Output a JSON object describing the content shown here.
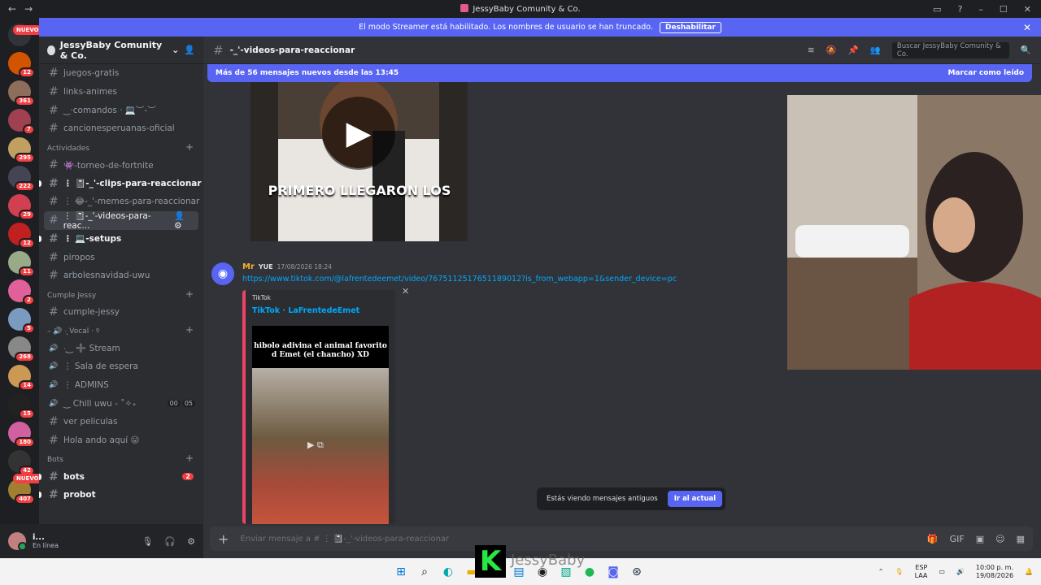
{
  "window": {
    "title": "JessyBaby Comunity & Co."
  },
  "banner": {
    "text": "El modo Streamer está habilitado. Los nombres de usuario se han truncado.",
    "button": "Deshabilitar"
  },
  "server": {
    "name": "JessyBaby Comunity & Co."
  },
  "guild_badges": [
    "NUEVO",
    "12",
    "361",
    "7",
    "295",
    "222",
    "29",
    "12",
    "11",
    "2",
    "5",
    "268",
    "14",
    "15",
    "180",
    "42",
    "407"
  ],
  "sidebar": {
    "channels_top": [
      "juegos-gratis",
      "links-animes",
      "‿·comandos · 💻︶-︶",
      "cancionesperuanas-oficial"
    ],
    "cat_actividades": "Actividades",
    "actividades": [
      "👾-torneo-de-fortnite",
      "⋮ 📓-_'-clips-para-reaccionar",
      "⋮ 😂-_'-memes-para-reaccionar",
      "⋮ 📓-_'-videos-para-reac...",
      "⋮ 💻-setups",
      "piropos",
      "arbolesnavidad-uwu"
    ],
    "cat_cumple": "Cumple Jessy",
    "cumple": [
      "cumple-jessy"
    ],
    "cat_vocal": "– 🔊 ·̩͙ Vocal · ୨",
    "vocal": [
      "·̩͙‿ ➕ Stream",
      "⋮ Sala de espera",
      "⋮ ADMINS",
      "‿ Chill uwu - ˚✧₊",
      "ver peliculas",
      "Hola ando aquí 😛"
    ],
    "vc_counts": [
      "00",
      "05"
    ],
    "cat_bots": "Bots",
    "bots": [
      "bots",
      "probot"
    ],
    "bots_mention": "2"
  },
  "user": {
    "name": "i...",
    "status": "En línea"
  },
  "channel": {
    "name": "-_'-videos-para-reaccionar",
    "search_placeholder": "Buscar JessyBaby Comunity & Co."
  },
  "new_messages": {
    "text": "Más de 56 mensajes nuevos desde las 13:45",
    "mark": "Marcar como leído"
  },
  "video1": {
    "caption": "PRIMERO LLEGARON LOS"
  },
  "message": {
    "author": "Mr",
    "tag": "YUE",
    "timestamp": "17/08/2026 18:24",
    "link": "https://www.tiktok.com/@lafrentedeemet/video/7675112517651189012?is_from_webapp=1&sender_device=pc"
  },
  "embed": {
    "provider": "TikTok",
    "title": "TikTok · LaFrentedeEmet",
    "thumb_text": "hibolo adivina el animal favorito d Emet (el chancho) XD"
  },
  "old_messages": {
    "text": "Estás viendo mensajes antiguos",
    "button": "Ir al actual"
  },
  "composer": {
    "placeholder": "Enviar mensaje a # ⋮ 📓-_'-videos-para-reaccionar"
  },
  "taskbar": {
    "lang_top": "ESP",
    "lang_bottom": "LAA",
    "time": "10:00 p. m.",
    "date": "19/08/2026",
    "watermark": "JessyBaby"
  },
  "colors": {
    "blurple": "#5865f2",
    "bg": "#313338",
    "sidebar": "#2b2d31",
    "danger": "#f23f43"
  }
}
